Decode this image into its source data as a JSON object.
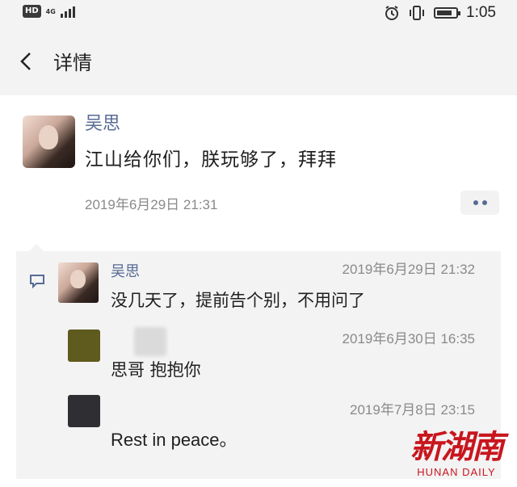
{
  "status_bar": {
    "hd_label": "HD",
    "network_label": "4G",
    "time": "1:05",
    "battery_level": 0.8,
    "icons": [
      "hd-icon",
      "signal-icon",
      "alarm-icon",
      "vibrate-icon",
      "battery-icon"
    ]
  },
  "header": {
    "title": "详情",
    "back_icon": "chevron-left-icon"
  },
  "post": {
    "author": "吴思",
    "text": "江山给你们，朕玩够了，拜拜",
    "timestamp": "2019年6月29日 21:31",
    "more_icon": "ellipsis-icon"
  },
  "comments": [
    {
      "author": "吴思",
      "timestamp": "2019年6月29日 21:32",
      "text": "没几天了，提前告个别，不用问了"
    },
    {
      "author": "",
      "timestamp": "2019年6月30日 16:35",
      "text": "思哥 抱抱你"
    },
    {
      "author": "",
      "timestamp": "2019年7月8日 23:15",
      "text": "Rest in peace。"
    }
  ],
  "watermark": {
    "chinese": "新湖南",
    "english": "HUNAN DAILY"
  },
  "colors": {
    "accent_blue": "#576b95",
    "background_gray": "#f3f3f3",
    "watermark_red": "#c8161e"
  }
}
